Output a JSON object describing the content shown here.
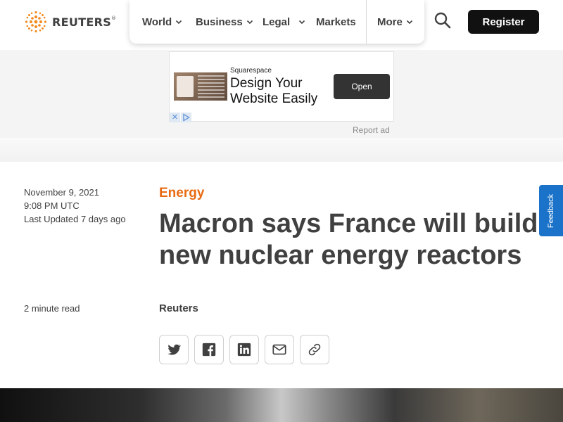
{
  "header": {
    "logo_text": "REUTERS",
    "logo_mark": "®",
    "nav": [
      {
        "label": "World",
        "has_dropdown": true
      },
      {
        "label": "Business",
        "has_dropdown": true
      },
      {
        "label": "Legal",
        "has_dropdown": true
      },
      {
        "label": "Markets",
        "has_dropdown": false
      },
      {
        "label": "More",
        "has_dropdown": true
      }
    ],
    "search_icon": "search-icon",
    "register_label": "Register"
  },
  "ad": {
    "brand": "Squarespace",
    "headline": "Design Your Website Easily",
    "cta": "Open",
    "close_icon": "close-icon",
    "adchoices_icon": "adchoices-icon",
    "report_label": "Report ad"
  },
  "article": {
    "date": "November 9, 2021",
    "time": "9:08 PM UTC",
    "updated": "Last Updated 7 days ago",
    "read_time": "2 minute read",
    "section": "Energy",
    "headline": "Macron says France will build new nuclear energy reactors",
    "byline": "Reuters",
    "share": [
      {
        "name": "twitter",
        "icon": "twitter-icon"
      },
      {
        "name": "facebook",
        "icon": "facebook-icon"
      },
      {
        "name": "linkedin",
        "icon": "linkedin-icon"
      },
      {
        "name": "email",
        "icon": "email-icon"
      },
      {
        "name": "link",
        "icon": "link-icon"
      }
    ]
  },
  "feedback_label": "Feedback",
  "colors": {
    "accent": "#e86b13",
    "text": "#404040",
    "button_dark": "#111111",
    "feedback_blue": "#1a73c9"
  }
}
